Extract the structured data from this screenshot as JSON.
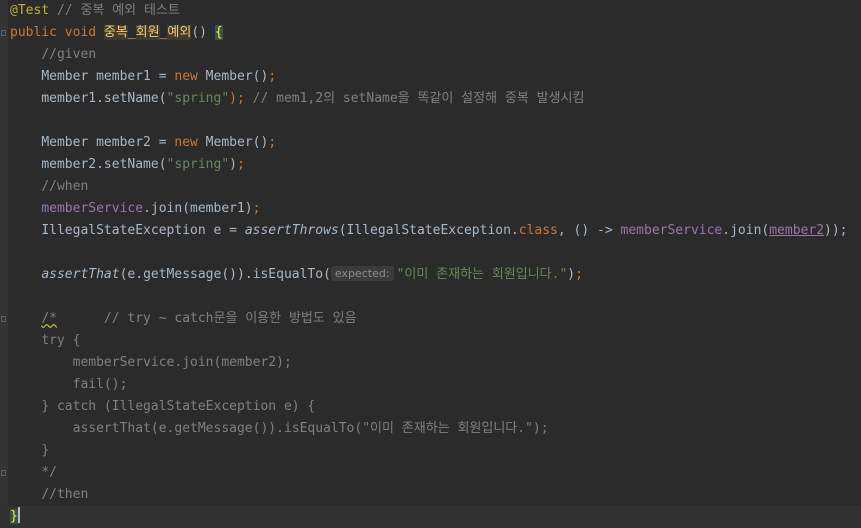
{
  "editor": {
    "l1": {
      "ann": "@Test",
      "com": " // 중복 예외 테스트"
    },
    "l2": {
      "kw1": "public void ",
      "n1": "중복",
      "s1": "_",
      "n2": "회원",
      "s2": "_",
      "n3": "예외",
      "rest": "() ",
      "brace": "{"
    },
    "l3": {
      "com": "//given"
    },
    "l4": {
      "t1": "Member member1 = ",
      "kw": "new",
      "t2": " Member()",
      ";": ";"
    },
    "l5": {
      "t1": "member1.setName(",
      "str": "\"spring\"",
      "t2": "); ",
      "com": "// mem1,2의 setName을 똑같이 설정해 중복 발생시킴"
    },
    "l7": {
      "t1": "Member member2 = ",
      "kw": "new",
      "t2": " Member()",
      ";": ";"
    },
    "l8": {
      "t1": "member2.setName(",
      "str": "\"spring\"",
      "t2": ")",
      ";": ";"
    },
    "l9": {
      "com": "//when"
    },
    "l10": {
      "f": "memberService",
      "t": ".join(member1)",
      ";": ";"
    },
    "l11": {
      "t1": "IllegalStateException e = ",
      "m": "assertThrows",
      "t2": "(IllegalStateException.",
      "kw": "class",
      "t3": ", () -> ",
      "f": "memberService",
      "t4": ".join(",
      "v": "member2",
      "t5": "));"
    },
    "l13": {
      "m": "assertThat",
      "t1": "(e.getMessage()).isEqualTo(",
      "hint": "expected:",
      "str": "\"이미 존재하는 회원입니다.\"",
      "t2": ")",
      ";": ";"
    },
    "l15": {
      "c1": "/*",
      "c2": "      // try ~ catch문을 이용한 방법도 있음"
    },
    "l16": {
      "c": "try {"
    },
    "l17": {
      "c": "memberService.join(member2);"
    },
    "l18": {
      "c": "fail();"
    },
    "l19": {
      "c": "} catch (IllegalStateException e) {"
    },
    "l20": {
      "c": "assertThat(e.getMessage()).isEqualTo(\"이미 존재하는 회원입니다.\");"
    },
    "l21": {
      "c": "}"
    },
    "l22": {
      "c": "*/"
    },
    "l23": {
      "com": "//then"
    },
    "l24": {
      "brace": "}"
    }
  }
}
